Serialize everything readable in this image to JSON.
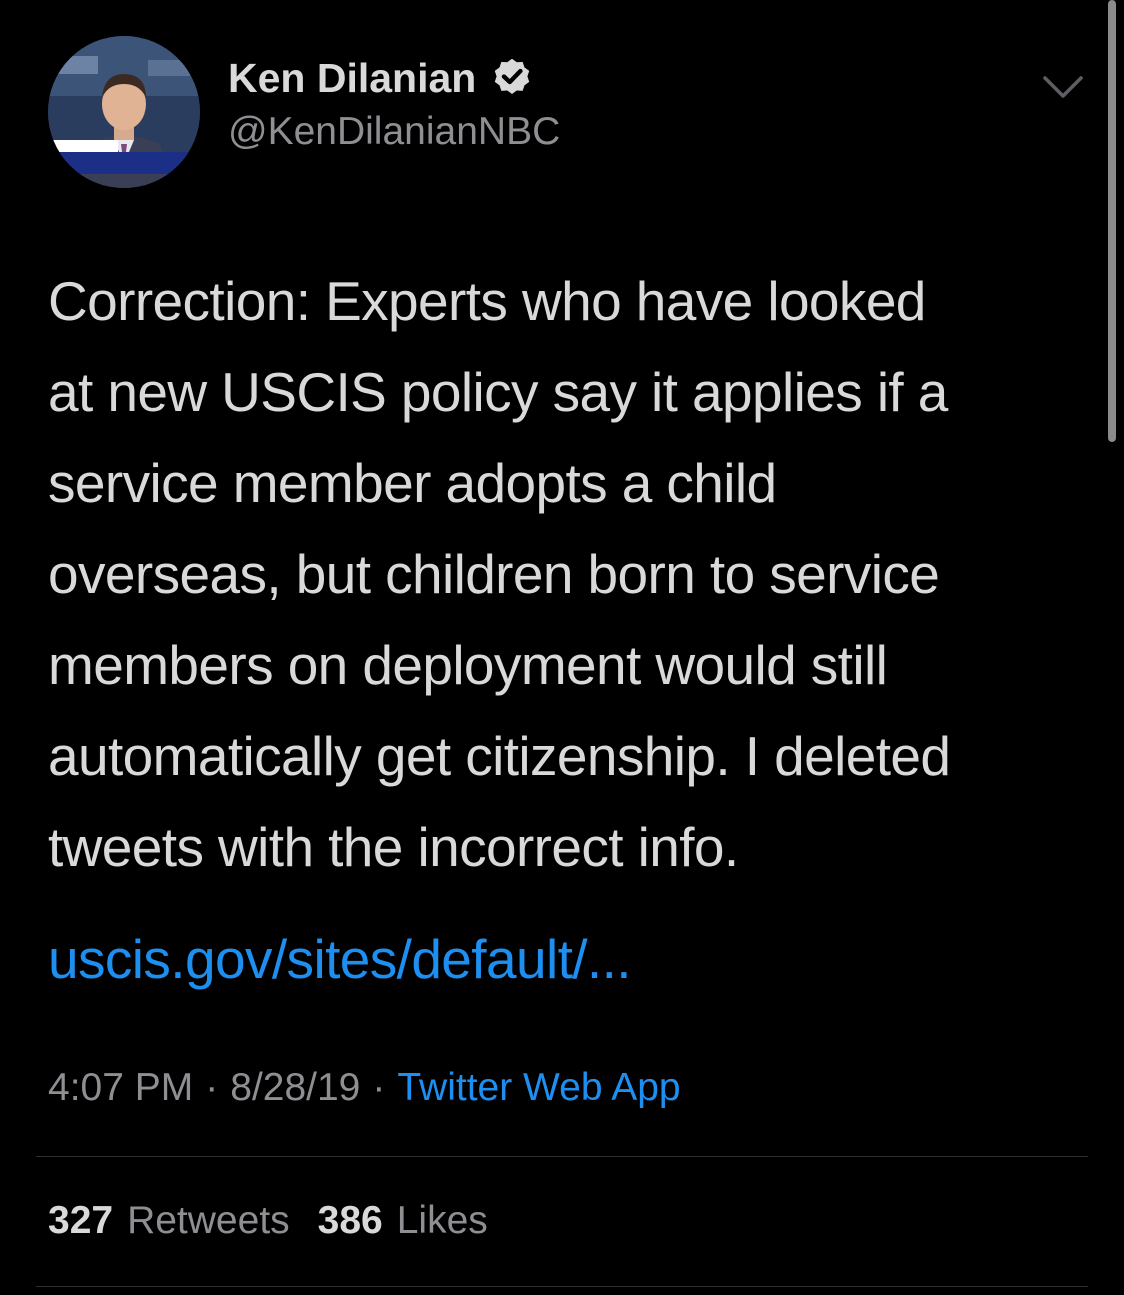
{
  "author": {
    "display_name": "Ken Dilanian",
    "handle": "@KenDilanianNBC",
    "verified": true,
    "avatar_icon": "profile-photo"
  },
  "tweet": {
    "text": "Correction: Experts who have looked\nat new USCIS policy say it applies if a\nservice member adopts a child\noverseas, but children born to service\nmembers on deployment would still\nautomatically get citizenship. I deleted\ntweets with the incorrect info.",
    "link": "uscis.gov/sites/default/..."
  },
  "meta": {
    "time": "4:07 PM",
    "separator": "·",
    "date": "8/28/19",
    "source": "Twitter Web App"
  },
  "stats": {
    "retweets_count": "327",
    "retweets_label": "Retweets",
    "likes_count": "386",
    "likes_label": "Likes"
  },
  "colors": {
    "background": "#000000",
    "primary_text": "#d9d9d9",
    "secondary_text": "#8e8e93",
    "link": "#1d8ff0",
    "divider": "#2f2f33"
  }
}
